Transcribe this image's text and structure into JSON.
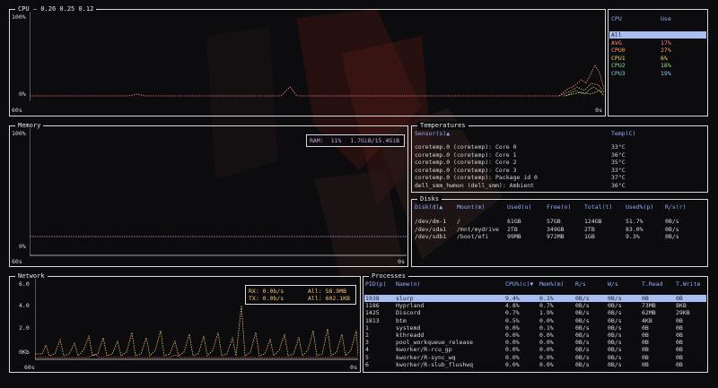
{
  "cpu": {
    "title": "CPU",
    "load": "0.26 0.25 0.12",
    "y_top": "100%",
    "y_bottom": "0%",
    "x_left": "60s",
    "x_right": "0s",
    "table_header": {
      "name": "CPU",
      "use": "Use"
    },
    "rows": [
      {
        "name": "All",
        "use": "",
        "color": "#202030"
      },
      {
        "name": "AVG",
        "use": "17%",
        "color": "#ff8a8a"
      },
      {
        "name": "CPU0",
        "use": "27%",
        "color": "#ff9d5c"
      },
      {
        "name": "CPU1",
        "use": "6%",
        "color": "#f5d76e"
      },
      {
        "name": "CPU2",
        "use": "18%",
        "color": "#8ee28e"
      },
      {
        "name": "CPU3",
        "use": "19%",
        "color": "#7fd0e0"
      }
    ]
  },
  "memory": {
    "title": "Memory",
    "y_top": "100%",
    "y_bottom": "0%",
    "x_left": "60s",
    "x_right": "0s",
    "ram_label": "RAM:",
    "ram_pct": "11%",
    "ram_used": "1.7GiB/15.4GiB"
  },
  "temps": {
    "title": "Temperatures",
    "header": {
      "sensor": "Sensor(s)▲",
      "temp": "Temp(C)"
    },
    "rows": [
      {
        "sensor": "coretemp.0 (coretemp): Core 0",
        "temp": "33°C"
      },
      {
        "sensor": "coretemp.0 (coretemp): Core 1",
        "temp": "36°C"
      },
      {
        "sensor": "coretemp.0 (coretemp): Core 2",
        "temp": "35°C"
      },
      {
        "sensor": "coretemp.0 (coretemp): Core 3",
        "temp": "33°C"
      },
      {
        "sensor": "coretemp.0 (coretemp): Package id 0",
        "temp": "37°C"
      },
      {
        "sensor": "dell_smm_hwmon (dell_smm): Ambient",
        "temp": "36°C"
      }
    ]
  },
  "disks": {
    "title": "Disks",
    "header": {
      "disk": "Disk(d)▲",
      "mount": "Mount(m)",
      "used": "Used(u)",
      "free": "Free(n)",
      "total": "Total(t)",
      "usedpct": "Used%(p)",
      "rs": "R/s(r)"
    },
    "rows": [
      {
        "disk": "/dev/dm-1",
        "mount": "/",
        "used": "61GB",
        "free": "57GB",
        "total": "124GB",
        "usedpct": "51.7%",
        "rs": "0B/s"
      },
      {
        "disk": "/dev/sda1",
        "mount": "/mnt/mydrive",
        "used": "2TB",
        "free": "349GB",
        "total": "2TB",
        "usedpct": "83.0%",
        "rs": "0B/s"
      },
      {
        "disk": "/dev/sdb1",
        "mount": "/boot/efi",
        "used": "99MB",
        "free": "972MB",
        "total": "1GB",
        "usedpct": "9.3%",
        "rs": "0B/s"
      }
    ]
  },
  "network": {
    "title": "Network",
    "y_labels": [
      "6.0",
      "4.0",
      "2.0",
      "0Kb"
    ],
    "x_left": "60s",
    "x_right": "0s",
    "rx": "RX: 0.0b/s",
    "tx": "TX: 0.0b/s",
    "all_rx": "All: 58.9MB",
    "all_tx": "All: 602.1KB"
  },
  "processes": {
    "title": "Processes",
    "header": {
      "pid": "PID(p)",
      "name": "Name(n)",
      "cpu": "CPU%(c)▼",
      "mem": "Mem%(m)",
      "rs": "R/s",
      "ws": "W/s",
      "tread": "T.Read",
      "twrite": "T.Write"
    },
    "rows": [
      {
        "pid": "1938",
        "name": "slurp",
        "cpu": "9.4%",
        "mem": "0.1%",
        "rs": "0B/s",
        "ws": "0B/s",
        "tread": "0B",
        "twrite": "0B"
      },
      {
        "pid": "1186",
        "name": "Hyprland",
        "cpu": "4.8%",
        "mem": "0.7%",
        "rs": "0B/s",
        "ws": "0B/s",
        "tread": "73MB",
        "twrite": "8KB"
      },
      {
        "pid": "1425",
        "name": "Discord",
        "cpu": "0.7%",
        "mem": "1.9%",
        "rs": "0B/s",
        "ws": "0B/s",
        "tread": "62MB",
        "twrite": "29KB"
      },
      {
        "pid": "1813",
        "name": "btm",
        "cpu": "0.5%",
        "mem": "0.0%",
        "rs": "0B/s",
        "ws": "0B/s",
        "tread": "4KB",
        "twrite": "0B"
      },
      {
        "pid": "1",
        "name": "systemd",
        "cpu": "0.0%",
        "mem": "0.1%",
        "rs": "0B/s",
        "ws": "0B/s",
        "tread": "0B",
        "twrite": "0B"
      },
      {
        "pid": "2",
        "name": "kthreadd",
        "cpu": "0.0%",
        "mem": "0.0%",
        "rs": "0B/s",
        "ws": "0B/s",
        "tread": "0B",
        "twrite": "0B"
      },
      {
        "pid": "3",
        "name": "pool_workqueue_release",
        "cpu": "0.0%",
        "mem": "0.0%",
        "rs": "0B/s",
        "ws": "0B/s",
        "tread": "0B",
        "twrite": "0B"
      },
      {
        "pid": "4",
        "name": "kworker/R-rcu_gp",
        "cpu": "0.0%",
        "mem": "0.0%",
        "rs": "0B/s",
        "ws": "0B/s",
        "tread": "0B",
        "twrite": "0B"
      },
      {
        "pid": "5",
        "name": "kworker/R-sync_wq",
        "cpu": "0.0%",
        "mem": "0.0%",
        "rs": "0B/s",
        "ws": "0B/s",
        "tread": "0B",
        "twrite": "0B"
      },
      {
        "pid": "6",
        "name": "kworker/R-slub_flushwq",
        "cpu": "0.0%",
        "mem": "0.0%",
        "rs": "0B/s",
        "ws": "0B/s",
        "tread": "0B",
        "twrite": "0B"
      }
    ]
  },
  "colors": {
    "border": "#d9d9d9",
    "header": "#8fb0ff",
    "selected": "#a9bdf0",
    "net_rx": "#f0c070",
    "net_tx": "#e07050",
    "mem_line": "#c9a4e0"
  }
}
